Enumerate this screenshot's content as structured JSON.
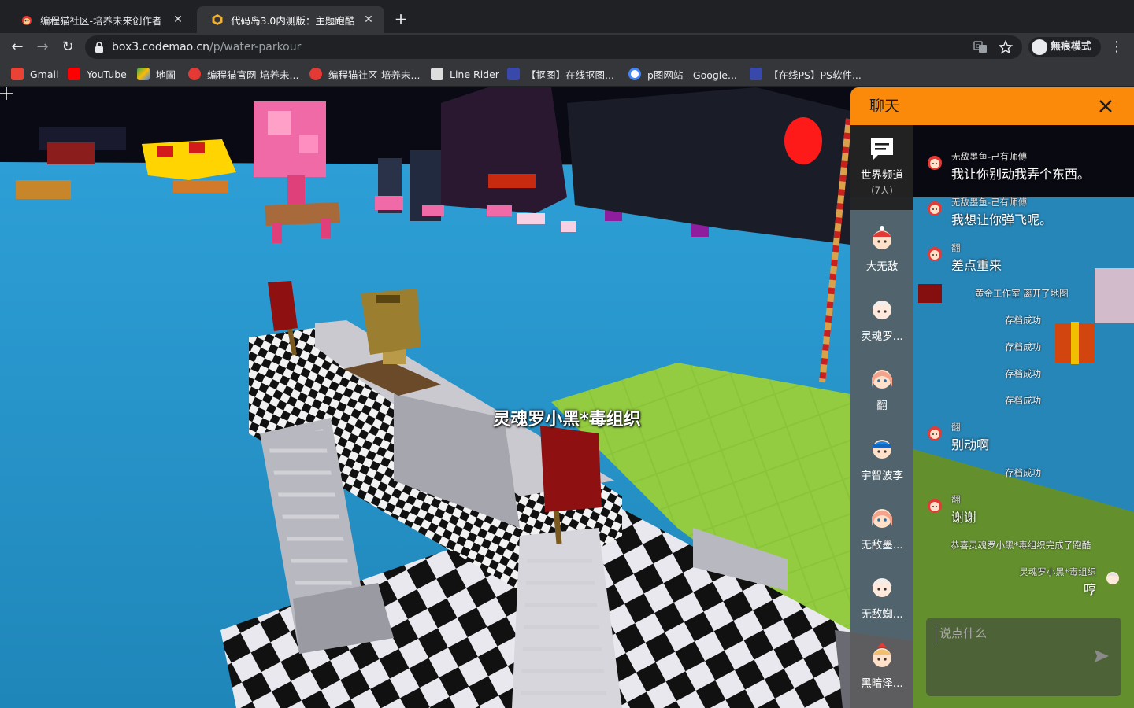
{
  "tabs": [
    {
      "title": "编程猫社区-培养未来创作者",
      "close": "✕"
    },
    {
      "title": "代码岛3.0内测版：主题跑酷",
      "close": "✕"
    }
  ],
  "newtab": "+",
  "toolbar": {
    "back": "←",
    "forward": "→",
    "reload": "↻",
    "url_host": "box3.codemao.cn",
    "url_path": "/p/water-parkour",
    "incognito_label": "無痕模式",
    "menu": "⋮"
  },
  "bookmarks": [
    {
      "label": "Gmail",
      "color": "#ea4335"
    },
    {
      "label": "YouTube",
      "color": "#ff0000"
    },
    {
      "label": "地圖",
      "color": "#34a853"
    },
    {
      "label": "编程猫官网-培养未...",
      "color": "#e53935"
    },
    {
      "label": "编程猫社区-培养未...",
      "color": "#e53935"
    },
    {
      "label": "Line Rider",
      "color": "#dddddd"
    },
    {
      "label": "【抠图】在线抠图...",
      "color": "#3949ab"
    },
    {
      "label": "p图网站 - Google...",
      "color": "#4285f4"
    },
    {
      "label": "【在线PS】PS软件...",
      "color": "#3949ab"
    }
  ],
  "game": {
    "player_name": "灵魂罗小黑*毒组织"
  },
  "chat": {
    "title": "聊天",
    "accent": "#fb8a0a",
    "world_channel": {
      "name": "世界频道",
      "count": "(7人)"
    },
    "users": [
      {
        "name": "大无敌",
        "hat": "#e53935"
      },
      {
        "name": "灵魂罗...",
        "hat": "#eeeeee"
      },
      {
        "name": "翻",
        "hat": "#f4a48c"
      },
      {
        "name": "宇智波李",
        "hat": "#1e88e5"
      },
      {
        "name": "无敌墨...",
        "hat": "#f4a48c"
      },
      {
        "name": "无敌蜘...",
        "hat": "#eeeeee"
      },
      {
        "name": "黑暗泽...",
        "hat": "#e53935"
      }
    ],
    "messages": [
      {
        "sender": "无敌墨鱼-己有师傅",
        "text": "我让你别动我弄个东西。"
      },
      {
        "sender": "无敌墨鱼-己有师傅",
        "text": "我想让你弹飞呢。"
      },
      {
        "sender": "翻",
        "text": "差点重来"
      },
      {
        "sender": "翻",
        "text": "别动啊"
      },
      {
        "sender": "翻",
        "text": "谢谢"
      }
    ],
    "system": {
      "left_map": "黄金工作室 离开了地图",
      "saved": "存档成功",
      "congrats": "恭喜灵魂罗小黑*毒组织完成了跑酷"
    },
    "own_message": {
      "sender": "灵魂罗小黑*毒组织",
      "text": "哼"
    },
    "input_placeholder": "说点什么"
  }
}
